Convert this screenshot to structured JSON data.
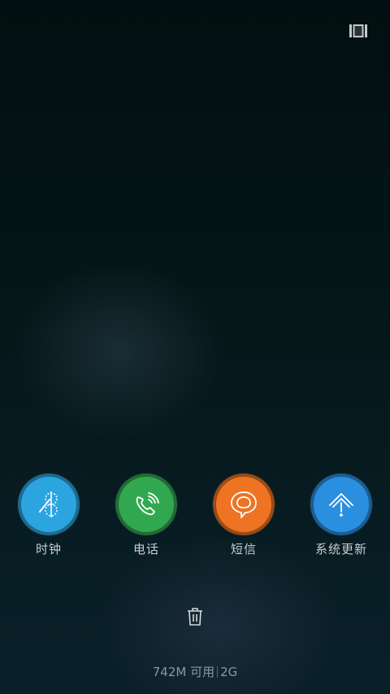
{
  "top_bar": {
    "layout_icon": "layout-toggle-icon"
  },
  "recent_apps": [
    {
      "label": "时钟",
      "icon": "clock-icon",
      "color": "#2ba4e0"
    },
    {
      "label": "电话",
      "icon": "phone-icon",
      "color": "#31a84f"
    },
    {
      "label": "短信",
      "icon": "message-icon",
      "color": "#ee7423"
    },
    {
      "label": "系统更新",
      "icon": "system-update-icon",
      "color": "#2b8fe0"
    }
  ],
  "clear_button": {
    "icon": "trash-icon"
  },
  "memory": {
    "available": "742M 可用",
    "total": "2G"
  }
}
